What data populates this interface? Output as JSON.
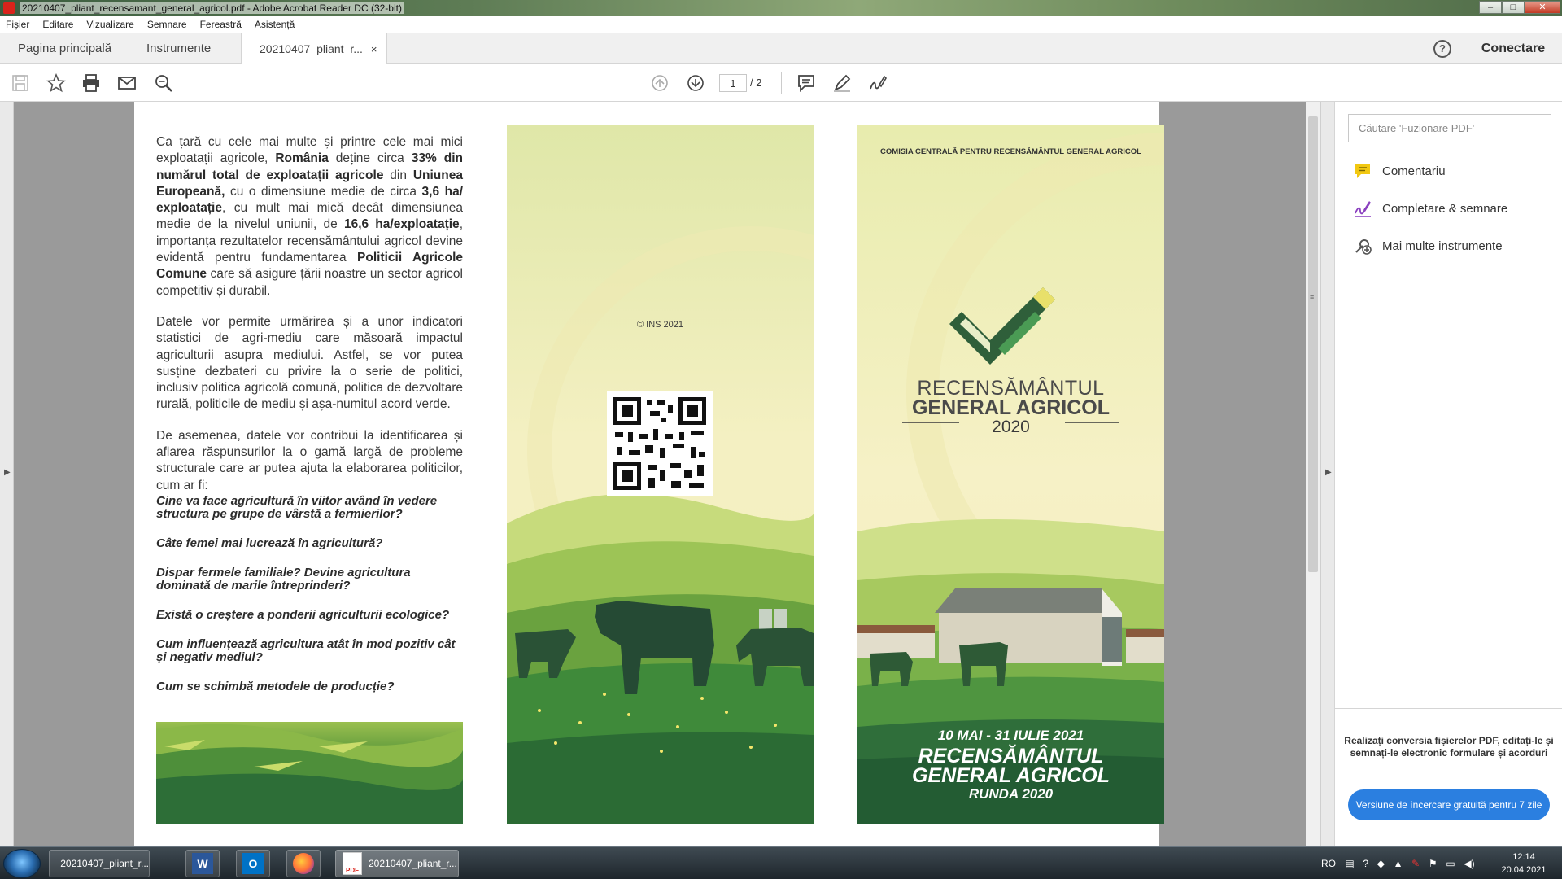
{
  "window": {
    "title": "20210407_pliant_recensamant_general_agricol.pdf - Adobe Acrobat Reader DC (32-bit)",
    "controls": [
      "–",
      "□",
      "✕"
    ]
  },
  "menu": [
    "Fișier",
    "Editare",
    "Vizualizare",
    "Semnare",
    "Fereastră",
    "Asistență"
  ],
  "tabs": {
    "home": "Pagina principală",
    "tools": "Instrumente",
    "document": "20210407_pliant_r...",
    "close": "×"
  },
  "header_right": {
    "help": "?",
    "connect": "Conectare"
  },
  "toolbar": {
    "icons": [
      "save-icon",
      "bookmark-star-icon",
      "print-icon",
      "email-icon",
      "zoom-search-icon",
      "page-up-icon",
      "page-down-icon",
      "comment-icon",
      "highlight-pen-icon",
      "sign-icon"
    ],
    "page_current": "1",
    "page_total": "/ 2"
  },
  "document": {
    "left": {
      "p1_parts": [
        {
          "t": "Ca țară cu cele mai multe și printre cele mai mici exploatații agricole, ",
          "b": false
        },
        {
          "t": "România",
          "b": true
        },
        {
          "t": " deține circa ",
          "b": false
        },
        {
          "t": "33% din numărul total de exploatații agricole",
          "b": true
        },
        {
          "t": " din ",
          "b": false
        },
        {
          "t": "Uniunea Europeană,",
          "b": true
        },
        {
          "t": " cu o dimensiune medie de circa ",
          "b": false
        },
        {
          "t": "3,6 ha/ exploatație",
          "b": true
        },
        {
          "t": ", cu mult mai mică decât dimensiunea medie de la nivelul uniunii, de ",
          "b": false
        },
        {
          "t": "16,6 ha/exploatație",
          "b": true
        },
        {
          "t": ", importanța rezultatelor recensământului agricol devine evidentă pentru fundamentarea ",
          "b": false
        },
        {
          "t": "Politicii Agricole Comune",
          "b": true
        },
        {
          "t": " care să asigure țării noastre un sector agricol competitiv și durabil.",
          "b": false
        }
      ],
      "p2": "Datele vor permite urmărirea și a unor indicatori statistici de agri-mediu care măsoară impactul agriculturii asupra mediului. Astfel, se vor putea susține dezbateri cu privire la o serie de politici, inclusiv politica agricolă comună, politica de dezvoltare rurală, politicile de mediu și așa-numitul acord verde.",
      "p3": "De asemenea, datele vor contribui la identificarea și aflarea răspunsurilor la o gamă largă de probleme structurale care ar putea ajuta la elaborarea politicilor, cum ar fi:",
      "questions": [
        "Cine va face agricultură în viitor având în vedere structura pe grupe de vârstă a fermierilor?",
        "Câte femei mai lucrează în agricultură?",
        "Dispar fermele familiale? Devine agricultura dominată de marile întreprinderi?",
        "Există o creștere a ponderii agriculturii ecologice?",
        "Cum influențează agricultura atât în mod pozitiv cât și negativ mediul?",
        "Cum se schimbă metodele de producție?"
      ]
    },
    "middle": {
      "copyright": "© INS 2021"
    },
    "right": {
      "commission": "COMISIA CENTRALĂ PENTRU RECENSĂMÂNTUL GENERAL AGRICOL",
      "logo_line1": "RECENSĂMÂNTUL",
      "logo_line2": "GENERAL AGRICOL",
      "logo_year": "2020",
      "dates": "10 MAI - 31 IULIE 2021",
      "banner_line1": "RECENSĂMÂNTUL",
      "banner_line2": "GENERAL AGRICOL",
      "banner_line3": "RUNDA 2020"
    }
  },
  "sidepanel": {
    "search_placeholder": "Căutare 'Fuzionare PDF'",
    "items": [
      "Comentariu",
      "Completare & semnare",
      "Mai multe instrumente"
    ],
    "promo_text": "Realizați conversia fișierelor PDF, editați-le și semnați-le electronic formulare și acorduri",
    "promo_button": "Versiune de încercare gratuită pentru 7 zile"
  },
  "taskbar": {
    "chrome": "20210407_pliant_r...",
    "acrobat": "20210407_pliant_r...",
    "lang": "RO",
    "time": "12:14",
    "date": "20.04.2021"
  },
  "colors": {
    "accent_blue": "#2b7fe0",
    "dark_green": "#2f5f3a",
    "logo_green": "#3e8a4a",
    "logo_yellow": "#e8e06a"
  }
}
